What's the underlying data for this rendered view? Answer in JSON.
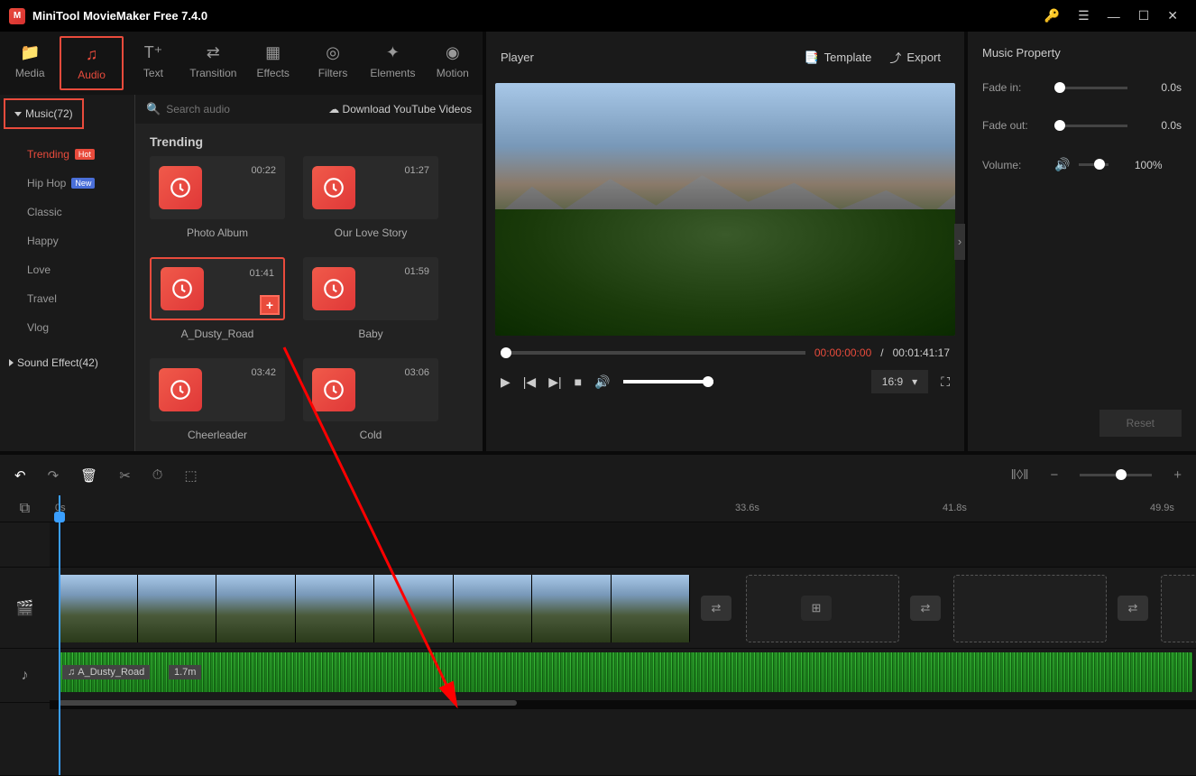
{
  "app": {
    "title": "MiniTool MovieMaker Free 7.4.0"
  },
  "tabs": {
    "media": "Media",
    "audio": "Audio",
    "text": "Text",
    "transition": "Transition",
    "effects": "Effects",
    "filters": "Filters",
    "elements": "Elements",
    "motion": "Motion"
  },
  "sidebar": {
    "music_header": "Music(72)",
    "sound_effect": "Sound Effect(42)",
    "categories": {
      "trending": "Trending",
      "hiphop": "Hip Hop",
      "classic": "Classic",
      "happy": "Happy",
      "love": "Love",
      "travel": "Travel",
      "vlog": "Vlog"
    },
    "badges": {
      "hot": "Hot",
      "new": "New"
    }
  },
  "search": {
    "placeholder": "Search audio",
    "download": "Download YouTube Videos"
  },
  "content": {
    "section": "Trending",
    "cards": [
      {
        "name": "Photo Album",
        "duration": "00:22"
      },
      {
        "name": "Our Love Story",
        "duration": "01:27"
      },
      {
        "name": "A_Dusty_Road",
        "duration": "01:41"
      },
      {
        "name": "Baby",
        "duration": "01:59"
      },
      {
        "name": "Cheerleader",
        "duration": "03:42"
      },
      {
        "name": "Cold",
        "duration": "03:06"
      }
    ]
  },
  "player": {
    "title": "Player",
    "template": "Template",
    "export": "Export",
    "time_current": "00:00:00:00",
    "time_sep": "/",
    "time_total": "00:01:41:17",
    "aspect": "16:9"
  },
  "props": {
    "title": "Music Property",
    "fade_in_label": "Fade in:",
    "fade_in_val": "0.0s",
    "fade_out_label": "Fade out:",
    "fade_out_val": "0.0s",
    "volume_label": "Volume:",
    "volume_val": "100%",
    "reset": "Reset"
  },
  "timeline": {
    "marks": {
      "m0": "0s",
      "m1": "33.6s",
      "m2": "41.8s",
      "m3": "49.9s"
    },
    "audio_clip_name": "A_Dusty_Road",
    "audio_clip_dur": "1.7m"
  }
}
